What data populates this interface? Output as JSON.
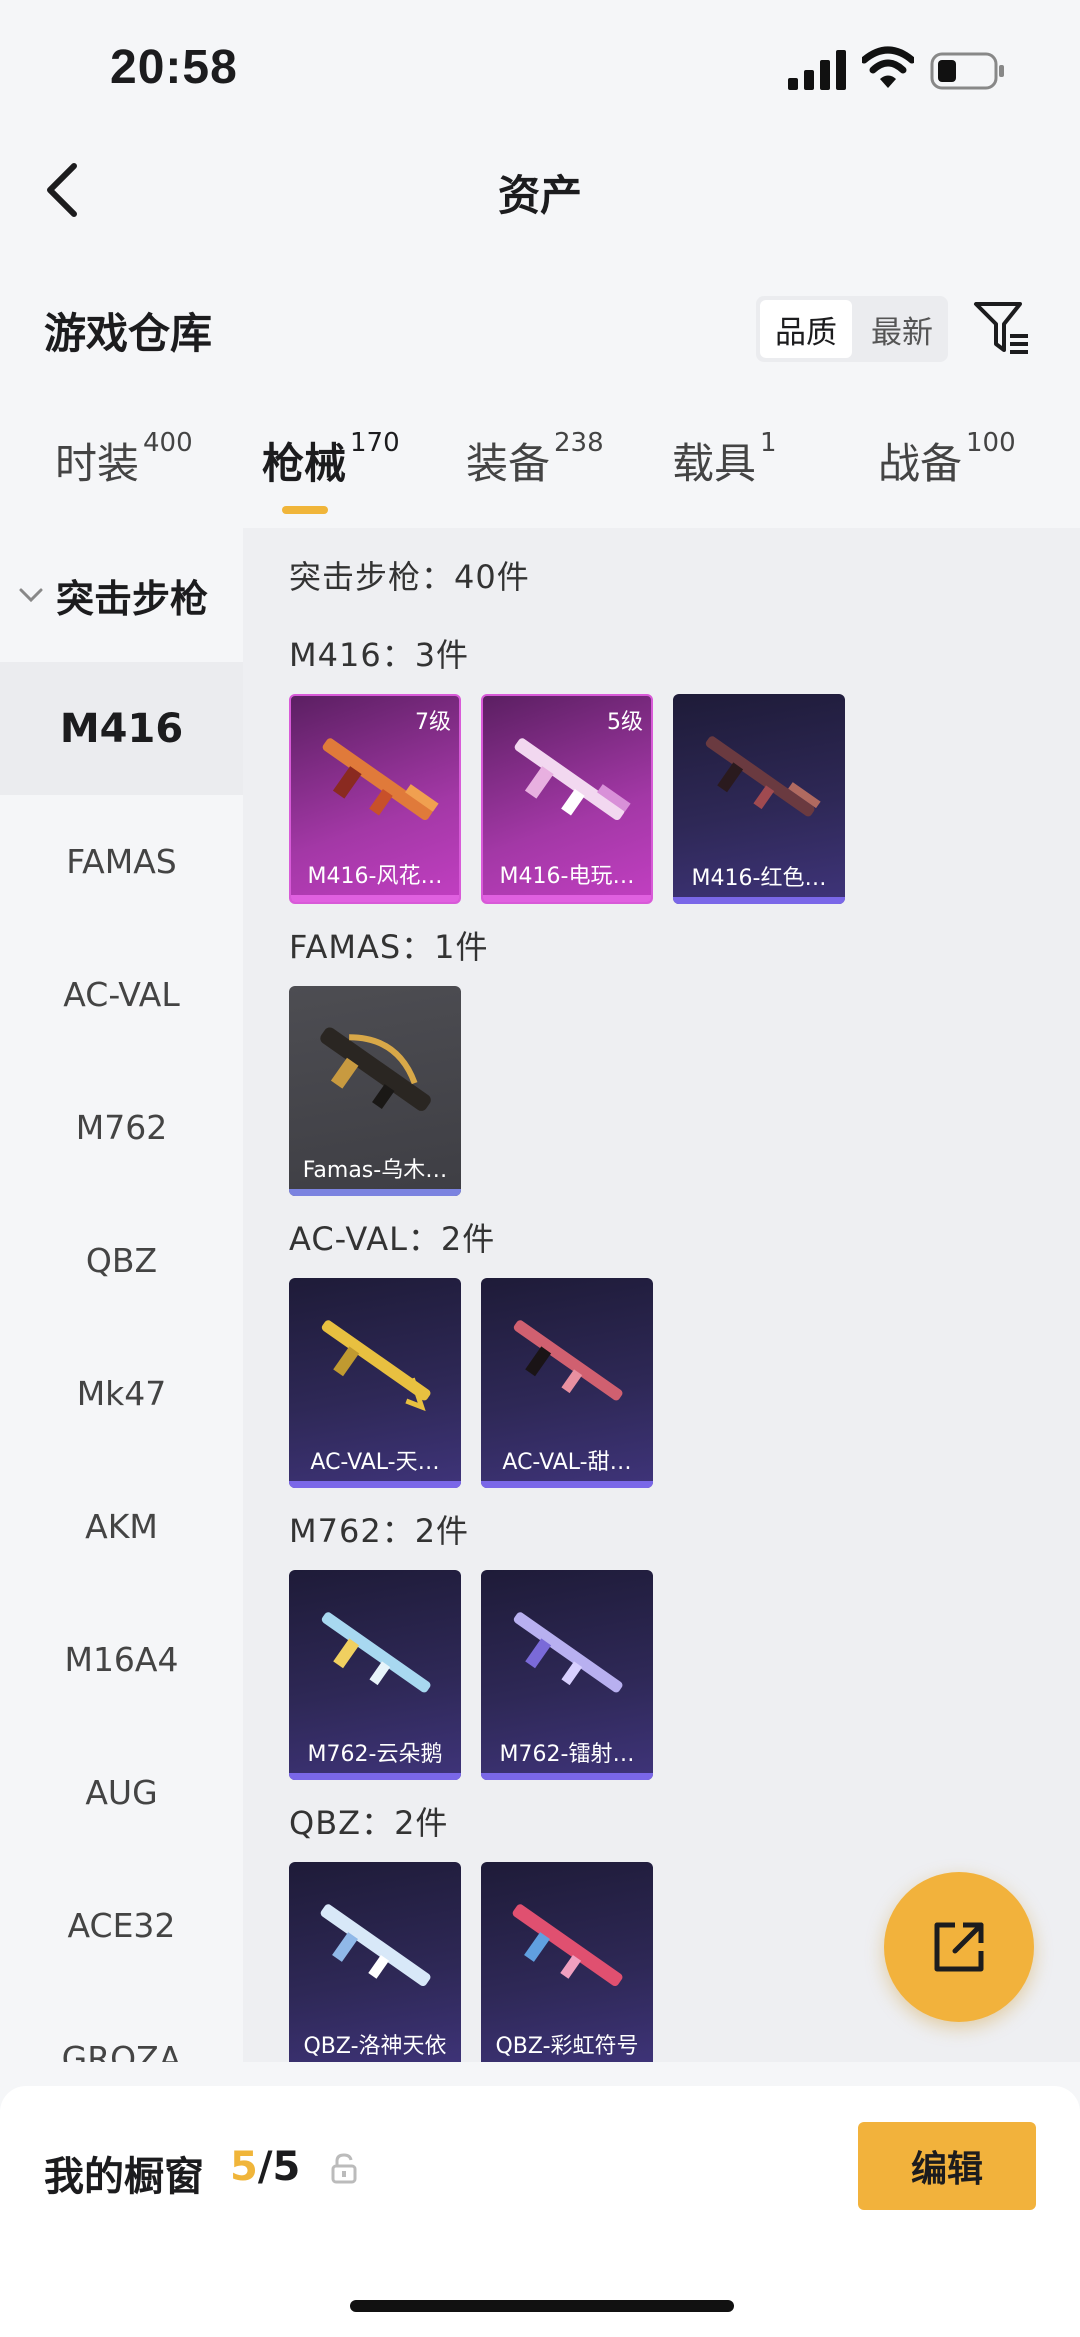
{
  "status_bar": {
    "time": "20:58"
  },
  "nav": {
    "title": "资产"
  },
  "warehouse": {
    "title": "游戏仓库",
    "sort_options": [
      "品质",
      "最新"
    ],
    "active_sort": "品质"
  },
  "tabs": [
    {
      "label": "时装",
      "count": "400"
    },
    {
      "label": "枪械",
      "count": "170"
    },
    {
      "label": "装备",
      "count": "238"
    },
    {
      "label": "载具",
      "count": "1"
    },
    {
      "label": "战备",
      "count": "100"
    }
  ],
  "sidebar": {
    "group": "突击步枪",
    "items": [
      "M416",
      "FAMAS",
      "AC-VAL",
      "M762",
      "QBZ",
      "Mk47",
      "AKM",
      "M16A4",
      "AUG",
      "ACE32",
      "GROZA"
    ],
    "active": "M416"
  },
  "content": {
    "summary": "突击步枪：40件",
    "sections": [
      {
        "title": "M416：3件",
        "items": [
          {
            "name": "M416-风花…",
            "level": "7级",
            "rarity": "legend"
          },
          {
            "name": "M416-电玩…",
            "level": "5级",
            "rarity": "legend"
          },
          {
            "name": "M416-红色…",
            "level": "",
            "rarity": "epic"
          }
        ]
      },
      {
        "title": "FAMAS：1件",
        "items": [
          {
            "name": "Famas-乌木…",
            "level": "",
            "rarity": "grey"
          }
        ]
      },
      {
        "title": "AC-VAL：2件",
        "items": [
          {
            "name": "AC-VAL-天…",
            "level": "",
            "rarity": "epic"
          },
          {
            "name": "AC-VAL-甜…",
            "level": "",
            "rarity": "epic"
          }
        ]
      },
      {
        "title": "M762：2件",
        "items": [
          {
            "name": "M762-云朵鹅",
            "level": "",
            "rarity": "epic"
          },
          {
            "name": "M762-镭射…",
            "level": "",
            "rarity": "epic"
          }
        ]
      },
      {
        "title": "QBZ：2件",
        "items": [
          {
            "name": "QBZ-洛神天依",
            "level": "",
            "rarity": "epic"
          },
          {
            "name": "QBZ-彩虹符号",
            "level": "",
            "rarity": "epic"
          }
        ]
      }
    ]
  },
  "bottom": {
    "label": "我的橱窗",
    "current": "5",
    "total": "/5",
    "edit_label": "编辑"
  },
  "colors": {
    "accent": "#f0b53a",
    "legend": "#c23fc2",
    "epic": "#3f347a"
  }
}
